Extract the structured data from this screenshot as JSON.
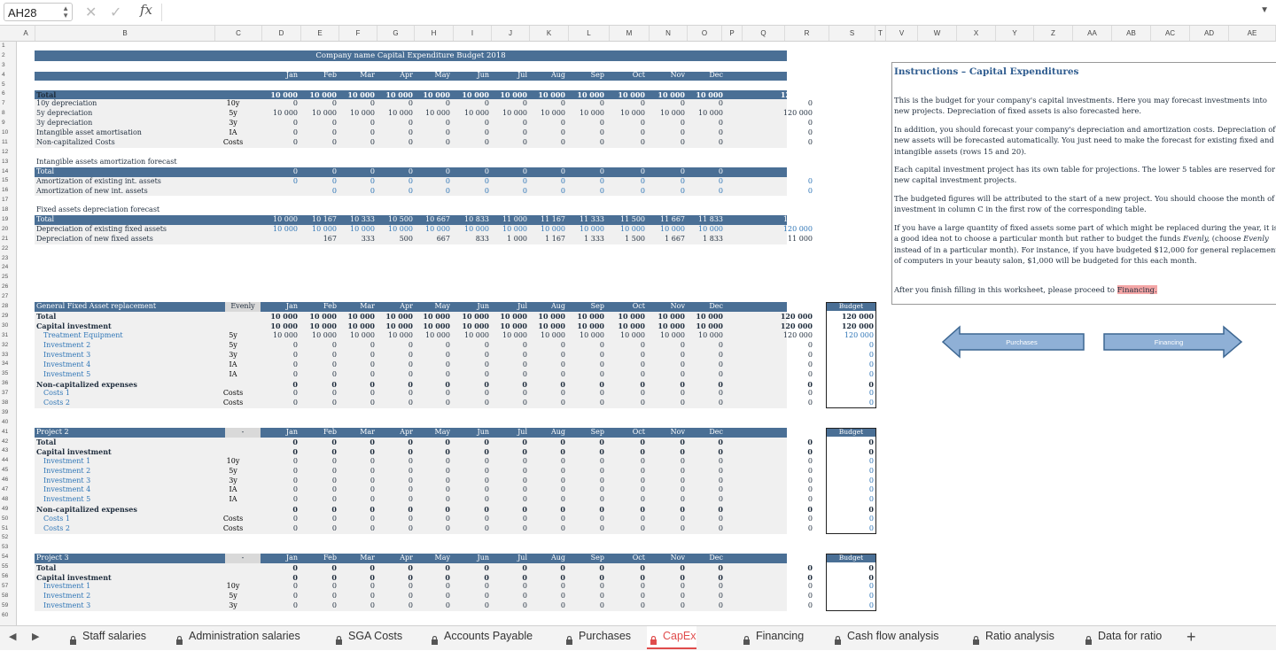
{
  "formula_bar": {
    "cell_ref": "AH28",
    "cancel_icon": "✕",
    "confirm_icon": "✓",
    "fx_label": "fx",
    "formula": ""
  },
  "columns": [
    "A",
    "B",
    "C",
    "D",
    "E",
    "F",
    "G",
    "H",
    "I",
    "J",
    "K",
    "L",
    "M",
    "N",
    "O",
    "P",
    "Q",
    "R",
    "S",
    "T",
    "V",
    "W",
    "X",
    "Y",
    "Z",
    "AA",
    "AB",
    "AC",
    "AD",
    "AE"
  ],
  "title": "Company name Capital Expenditure Budget 2018",
  "months": [
    "Jan",
    "Feb",
    "Mar",
    "Apr",
    "May",
    "Jun",
    "Jul",
    "Aug",
    "Sep",
    "Oct",
    "Nov",
    "Dec",
    "Total"
  ],
  "summary": {
    "rows": [
      {
        "label": "Total",
        "code": "",
        "vals": [
          "10 000",
          "10 000",
          "10 000",
          "10 000",
          "10 000",
          "10 000",
          "10 000",
          "10 000",
          "10 000",
          "10 000",
          "10 000",
          "10 000",
          "120 000"
        ]
      },
      {
        "label": "10y depreciation",
        "code": "10y",
        "vals": [
          "0",
          "0",
          "0",
          "0",
          "0",
          "0",
          "0",
          "0",
          "0",
          "0",
          "0",
          "0",
          "0"
        ]
      },
      {
        "label": "5y depreciation",
        "code": "5y",
        "vals": [
          "10 000",
          "10 000",
          "10 000",
          "10 000",
          "10 000",
          "10 000",
          "10 000",
          "10 000",
          "10 000",
          "10 000",
          "10 000",
          "10 000",
          "120 000"
        ]
      },
      {
        "label": "3y depreciation",
        "code": "3y",
        "vals": [
          "0",
          "0",
          "0",
          "0",
          "0",
          "0",
          "0",
          "0",
          "0",
          "0",
          "0",
          "0",
          "0"
        ]
      },
      {
        "label": "Intangible asset amortisation",
        "code": "IA",
        "vals": [
          "0",
          "0",
          "0",
          "0",
          "0",
          "0",
          "0",
          "0",
          "0",
          "0",
          "0",
          "0",
          "0"
        ]
      },
      {
        "label": "Non-capitalized Costs",
        "code": "Costs",
        "vals": [
          "0",
          "0",
          "0",
          "0",
          "0",
          "0",
          "0",
          "0",
          "0",
          "0",
          "0",
          "0",
          "0"
        ]
      }
    ]
  },
  "intangible": {
    "heading": "Intangible assets amortization forecast",
    "rows": [
      {
        "label": "Total",
        "vals": [
          "0",
          "0",
          "0",
          "0",
          "0",
          "0",
          "0",
          "0",
          "0",
          "0",
          "0",
          "0",
          "0"
        ]
      },
      {
        "label": "Amortization of existing int. assets",
        "vals": [
          "0",
          "0",
          "0",
          "0",
          "0",
          "0",
          "0",
          "0",
          "0",
          "0",
          "0",
          "0",
          "0"
        ]
      },
      {
        "label": "Amortization of new int. assets",
        "vals": [
          "",
          "0",
          "0",
          "0",
          "0",
          "0",
          "0",
          "0",
          "0",
          "0",
          "0",
          "0",
          "0"
        ]
      }
    ]
  },
  "fixed": {
    "heading": "Fixed assets depreciation forecast",
    "rows": [
      {
        "label": "Total",
        "vals": [
          "10 000",
          "10 167",
          "10 333",
          "10 500",
          "10 667",
          "10 833",
          "11 000",
          "11 167",
          "11 333",
          "11 500",
          "11 667",
          "11 833",
          "131 000"
        ]
      },
      {
        "label": "Depreciation of existing fixed assets",
        "vals": [
          "10 000",
          "10 000",
          "10 000",
          "10 000",
          "10 000",
          "10 000",
          "10 000",
          "10 000",
          "10 000",
          "10 000",
          "10 000",
          "10 000",
          "120 000"
        ]
      },
      {
        "label": "Depreciation of new fixed assets",
        "vals": [
          "",
          "167",
          "333",
          "500",
          "667",
          "833",
          "1 000",
          "1 167",
          "1 333",
          "1 500",
          "1 667",
          "1 833",
          "11 000"
        ]
      }
    ]
  },
  "projects": [
    {
      "name": "General Fixed Asset replacement",
      "timing": "Evenly",
      "budget_label": "Budget",
      "rows": [
        {
          "label": "Total",
          "code": "",
          "bold": true,
          "vals": [
            "10 000",
            "10 000",
            "10 000",
            "10 000",
            "10 000",
            "10 000",
            "10 000",
            "10 000",
            "10 000",
            "10 000",
            "10 000",
            "10 000",
            "120 000"
          ],
          "budget": "120 000"
        },
        {
          "label": "Capital investment",
          "code": "",
          "bold": true,
          "vals": [
            "10 000",
            "10 000",
            "10 000",
            "10 000",
            "10 000",
            "10 000",
            "10 000",
            "10 000",
            "10 000",
            "10 000",
            "10 000",
            "10 000",
            "120 000"
          ],
          "budget": "120 000"
        },
        {
          "label": "Treatment Equipment",
          "code": "5y",
          "blue": true,
          "vals": [
            "10 000",
            "10 000",
            "10 000",
            "10 000",
            "10 000",
            "10 000",
            "10 000",
            "10 000",
            "10 000",
            "10 000",
            "10 000",
            "10 000",
            "120 000"
          ],
          "budget": "120 000"
        },
        {
          "label": "Investment 2",
          "code": "5y",
          "blue": true,
          "vals": [
            "0",
            "0",
            "0",
            "0",
            "0",
            "0",
            "0",
            "0",
            "0",
            "0",
            "0",
            "0",
            "0"
          ],
          "budget": "0"
        },
        {
          "label": "Investment 3",
          "code": "3y",
          "blue": true,
          "vals": [
            "0",
            "0",
            "0",
            "0",
            "0",
            "0",
            "0",
            "0",
            "0",
            "0",
            "0",
            "0",
            "0"
          ],
          "budget": "0"
        },
        {
          "label": "Investment 4",
          "code": "IA",
          "blue": true,
          "vals": [
            "0",
            "0",
            "0",
            "0",
            "0",
            "0",
            "0",
            "0",
            "0",
            "0",
            "0",
            "0",
            "0"
          ],
          "budget": "0"
        },
        {
          "label": "Investment 5",
          "code": "IA",
          "blue": true,
          "vals": [
            "0",
            "0",
            "0",
            "0",
            "0",
            "0",
            "0",
            "0",
            "0",
            "0",
            "0",
            "0",
            "0"
          ],
          "budget": "0"
        },
        {
          "label": "Non-capitalized expenses",
          "code": "",
          "bold": true,
          "vals": [
            "0",
            "0",
            "0",
            "0",
            "0",
            "0",
            "0",
            "0",
            "0",
            "0",
            "0",
            "0",
            "0"
          ],
          "budget": "0"
        },
        {
          "label": "Costs 1",
          "code": "Costs",
          "blue": true,
          "vals": [
            "0",
            "0",
            "0",
            "0",
            "0",
            "0",
            "0",
            "0",
            "0",
            "0",
            "0",
            "0",
            "0"
          ],
          "budget": "0"
        },
        {
          "label": "Costs 2",
          "code": "Costs",
          "blue": true,
          "vals": [
            "0",
            "0",
            "0",
            "0",
            "0",
            "0",
            "0",
            "0",
            "0",
            "0",
            "0",
            "0",
            "0"
          ],
          "budget": "0"
        }
      ]
    },
    {
      "name": "Project 2",
      "timing": "-",
      "budget_label": "Budget",
      "rows": [
        {
          "label": "Total",
          "code": "",
          "bold": true,
          "vals": [
            "0",
            "0",
            "0",
            "0",
            "0",
            "0",
            "0",
            "0",
            "0",
            "0",
            "0",
            "0",
            "0"
          ],
          "budget": "0"
        },
        {
          "label": "Capital investment",
          "code": "",
          "bold": true,
          "vals": [
            "0",
            "0",
            "0",
            "0",
            "0",
            "0",
            "0",
            "0",
            "0",
            "0",
            "0",
            "0",
            "0"
          ],
          "budget": "0"
        },
        {
          "label": "Investment 1",
          "code": "10y",
          "blue": true,
          "vals": [
            "0",
            "0",
            "0",
            "0",
            "0",
            "0",
            "0",
            "0",
            "0",
            "0",
            "0",
            "0",
            "0"
          ],
          "budget": "0"
        },
        {
          "label": "Investment 2",
          "code": "5y",
          "blue": true,
          "vals": [
            "0",
            "0",
            "0",
            "0",
            "0",
            "0",
            "0",
            "0",
            "0",
            "0",
            "0",
            "0",
            "0"
          ],
          "budget": "0"
        },
        {
          "label": "Investment 3",
          "code": "3y",
          "blue": true,
          "vals": [
            "0",
            "0",
            "0",
            "0",
            "0",
            "0",
            "0",
            "0",
            "0",
            "0",
            "0",
            "0",
            "0"
          ],
          "budget": "0"
        },
        {
          "label": "Investment 4",
          "code": "IA",
          "blue": true,
          "vals": [
            "0",
            "0",
            "0",
            "0",
            "0",
            "0",
            "0",
            "0",
            "0",
            "0",
            "0",
            "0",
            "0"
          ],
          "budget": "0"
        },
        {
          "label": "Investment 5",
          "code": "IA",
          "blue": true,
          "vals": [
            "0",
            "0",
            "0",
            "0",
            "0",
            "0",
            "0",
            "0",
            "0",
            "0",
            "0",
            "0",
            "0"
          ],
          "budget": "0"
        },
        {
          "label": "Non-capitalized expenses",
          "code": "",
          "bold": true,
          "vals": [
            "0",
            "0",
            "0",
            "0",
            "0",
            "0",
            "0",
            "0",
            "0",
            "0",
            "0",
            "0",
            "0"
          ],
          "budget": "0"
        },
        {
          "label": "Costs 1",
          "code": "Costs",
          "blue": true,
          "vals": [
            "0",
            "0",
            "0",
            "0",
            "0",
            "0",
            "0",
            "0",
            "0",
            "0",
            "0",
            "0",
            "0"
          ],
          "budget": "0"
        },
        {
          "label": "Costs 2",
          "code": "Costs",
          "blue": true,
          "vals": [
            "0",
            "0",
            "0",
            "0",
            "0",
            "0",
            "0",
            "0",
            "0",
            "0",
            "0",
            "0",
            "0"
          ],
          "budget": "0"
        }
      ]
    },
    {
      "name": "Project 3",
      "timing": "-",
      "budget_label": "Budget",
      "rows": [
        {
          "label": "Total",
          "code": "",
          "bold": true,
          "vals": [
            "0",
            "0",
            "0",
            "0",
            "0",
            "0",
            "0",
            "0",
            "0",
            "0",
            "0",
            "0",
            "0"
          ],
          "budget": "0"
        },
        {
          "label": "Capital investment",
          "code": "",
          "bold": true,
          "vals": [
            "0",
            "0",
            "0",
            "0",
            "0",
            "0",
            "0",
            "0",
            "0",
            "0",
            "0",
            "0",
            "0"
          ],
          "budget": "0"
        },
        {
          "label": "Investment 1",
          "code": "10y",
          "blue": true,
          "vals": [
            "0",
            "0",
            "0",
            "0",
            "0",
            "0",
            "0",
            "0",
            "0",
            "0",
            "0",
            "0",
            "0"
          ],
          "budget": "0"
        },
        {
          "label": "Investment 2",
          "code": "5y",
          "blue": true,
          "vals": [
            "0",
            "0",
            "0",
            "0",
            "0",
            "0",
            "0",
            "0",
            "0",
            "0",
            "0",
            "0",
            "0"
          ],
          "budget": "0"
        },
        {
          "label": "Investment 3",
          "code": "3y",
          "blue": true,
          "vals": [
            "0",
            "0",
            "0",
            "0",
            "0",
            "0",
            "0",
            "0",
            "0",
            "0",
            "0",
            "0",
            "0"
          ],
          "budget": "0"
        }
      ]
    }
  ],
  "instructions": {
    "title": "Instructions – Capital Expenditures",
    "p1": "This is the budget for your company's capital investments. Here you may forecast investments into new projects. Depreciation of fixed assets is also forecasted here.",
    "p2": "In addition, you should forecast your company's depreciation and amortization costs. Depreciation of new assets will be forecasted automatically. You just need to make the forecast for existing fixed and intangible assets (rows 15 and 20).",
    "p3": "Each capital investment project has its own table for projections. The lower 5 tables are reserved for new capital investment projects.",
    "p4": "The budgeted figures will be attributed to the start of a new project. You should choose the month of investment in column C in the first row of the corresponding table.",
    "p5a": "If you have a large quantity of fixed assets some part of which might be replaced during the year, it is a good idea not to choose a particular month but rather to budget the funds ",
    "p5b": "Evenly,",
    "p5c": " (choose ",
    "p5d": "Evenly",
    "p5e": " instead of in a particular month). For instance, if you have budgeted $12,000 for general replacement of computers in your beauty salon, $1,000 will be budgeted for this each month.",
    "p6a": "After you finish filling in this worksheet, please proceed to ",
    "p6b": "Financing."
  },
  "nav_buttons": {
    "prev": "Purchases",
    "next": "Financing"
  },
  "tabs": [
    "Staff salaries",
    "Administration salaries",
    "SGA Costs",
    "Accounts Payable",
    "Purchases",
    "CapEx",
    "Financing",
    "Cash flow analysis",
    "Ratio analysis",
    "Data for ratio"
  ],
  "active_tab": "CapEx",
  "add_sheet": "+",
  "colors": {
    "header_blue": "#4a6f95",
    "active_tab": "#e04c4c",
    "input_blue": "#2e75b6"
  }
}
